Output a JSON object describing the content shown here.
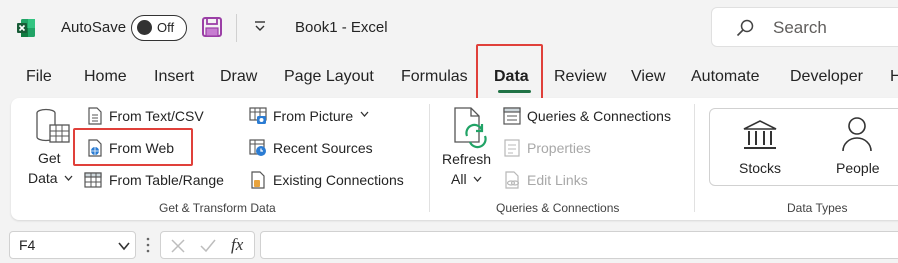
{
  "titlebar": {
    "app_icon": "excel-logo-icon",
    "autosave_label": "AutoSave",
    "autosave_state": "Off",
    "doc_title": "Book1  -  Excel",
    "search_placeholder": "Search"
  },
  "tabs": [
    "File",
    "Home",
    "Insert",
    "Draw",
    "Page Layout",
    "Formulas",
    "Data",
    "Review",
    "View",
    "Automate",
    "Developer",
    "H"
  ],
  "active_tab": "Data",
  "accent_color": "#217346",
  "highlight_color": "#e0403a",
  "ribbon": {
    "get_transform": {
      "get_data_line1": "Get",
      "get_data_line2": "Data",
      "from_text_csv": "From Text/CSV",
      "from_web": "From Web",
      "from_table_range": "From Table/Range",
      "from_picture": "From Picture",
      "recent_sources": "Recent Sources",
      "existing_connections": "Existing Connections",
      "label": "Get & Transform Data"
    },
    "queries": {
      "refresh_line1": "Refresh",
      "refresh_line2": "All",
      "queries_connections": "Queries & Connections",
      "properties": "Properties",
      "edit_links": "Edit Links",
      "label": "Queries & Connections"
    },
    "data_types": {
      "stocks": "Stocks",
      "people": "People",
      "label": "Data Types"
    }
  },
  "formula_bar": {
    "name_box": "F4",
    "fx_label": "fx",
    "formula_value": ""
  }
}
